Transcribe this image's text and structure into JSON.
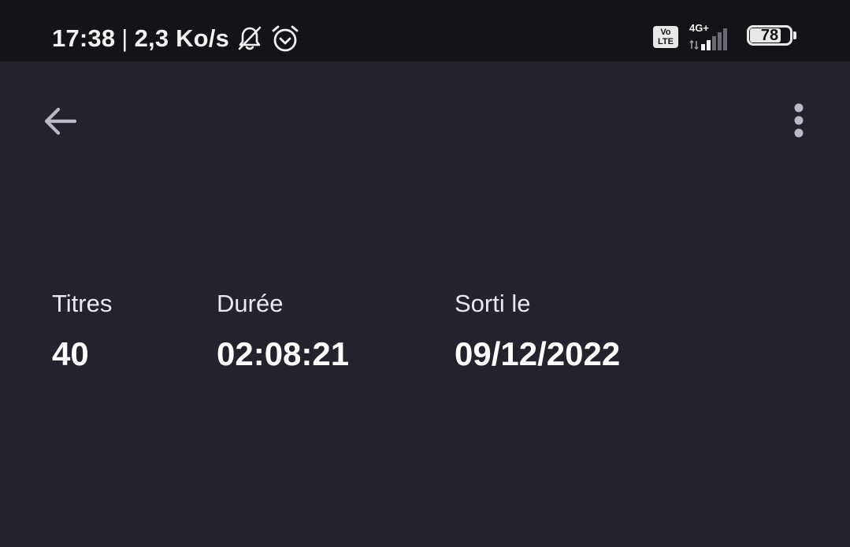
{
  "status_bar": {
    "time": "17:38",
    "separator": "|",
    "network_speed": "2,3 Ko/s",
    "icons": [
      "notifications-off-icon",
      "alarm-icon"
    ],
    "volte_top": "Vo",
    "volte_bottom": "LTE",
    "network_type": "4G+",
    "battery_level": "78",
    "colors": {
      "background": "#141418",
      "foreground": "#f2f2f2"
    }
  },
  "app_bar": {
    "back_icon": "arrow-left-icon",
    "more_icon": "more-vertical-icon"
  },
  "stats": {
    "titles_label": "Titres",
    "titles_value": "40",
    "duration_label": "Durée",
    "duration_value": "02:08:21",
    "release_label": "Sorti le",
    "release_value": "09/12/2022"
  },
  "colors": {
    "page_background": "#23232d",
    "icon_gray": "#b9b8c4",
    "text_primary": "#ffffff"
  }
}
